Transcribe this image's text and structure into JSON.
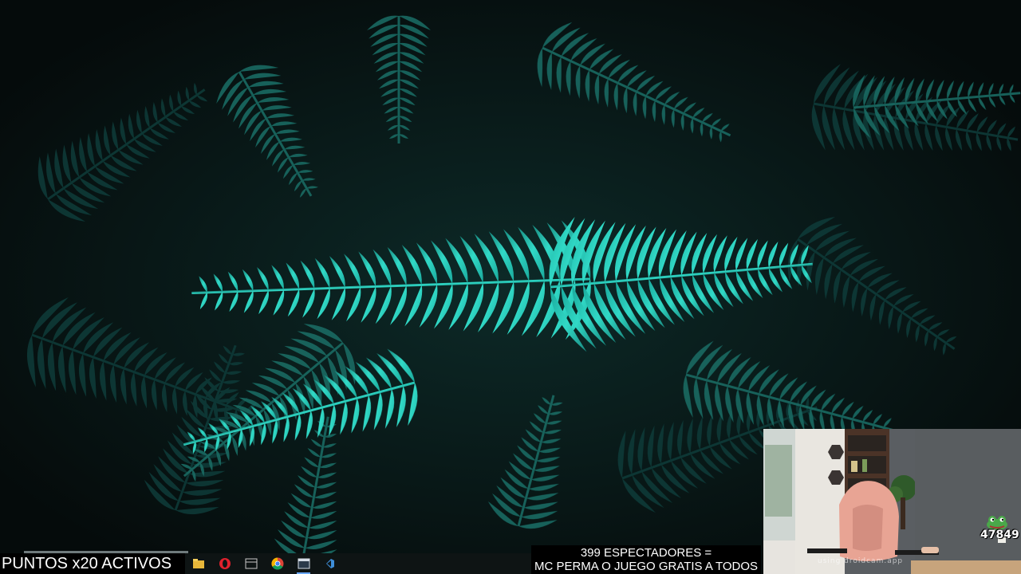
{
  "overlay": {
    "points_text": "PUNTOS x20 ACTIVOS",
    "viewers_line1": "399 ESPECTADORES =",
    "viewers_line2": "MC PERMA O JUEGO GRATIS A TODOS"
  },
  "taskbar": {
    "icons": [
      {
        "name": "file-explorer-icon"
      },
      {
        "name": "opera-icon"
      },
      {
        "name": "calendar-app-icon"
      },
      {
        "name": "chrome-icon"
      },
      {
        "name": "window-app-icon"
      },
      {
        "name": "visual-studio-icon"
      }
    ]
  },
  "webcam": {
    "watermark": "using droidcam.app",
    "counter": "47849"
  },
  "colors": {
    "wallpaper_bg": "#08100f",
    "fern_bright": "#2fd5c4",
    "fern_dark": "#0f3a38",
    "taskbar_accent": "#6aa8ff"
  }
}
